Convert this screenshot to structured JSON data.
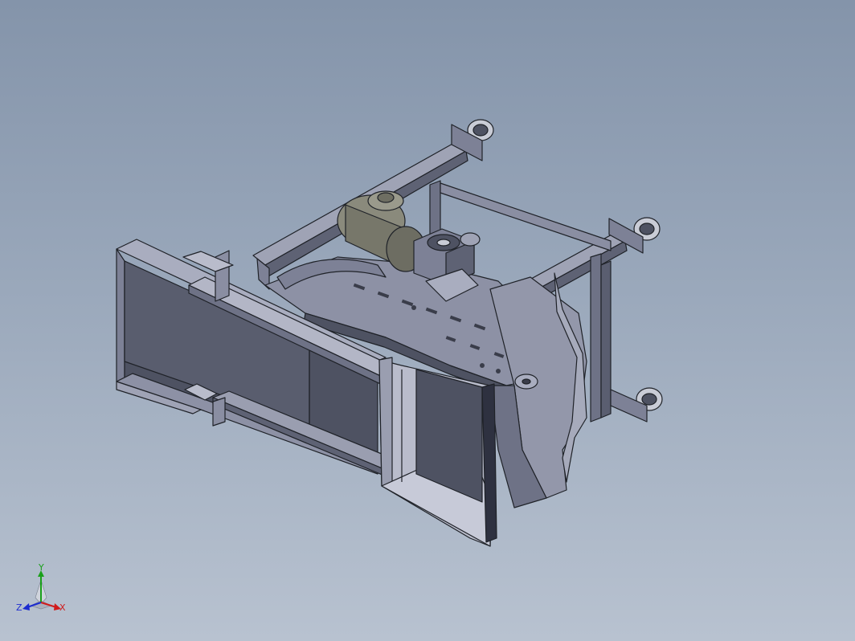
{
  "viewport": {
    "background_top": "#8494aa",
    "background_bottom": "#b8c2d0"
  },
  "model": {
    "name_icon": "conveyor-assembly-model",
    "edge_color": "#1f2228",
    "face_light": "#9b9fb2",
    "face_mid": "#7d8196",
    "face_dark": "#4e5262",
    "motor_color": "#8a8a7c"
  },
  "triad": {
    "x_label": "X",
    "y_label": "Y",
    "z_label": "Z",
    "x_color": "#d01c1c",
    "y_color": "#1aa01a",
    "z_color": "#1c2cd0"
  }
}
